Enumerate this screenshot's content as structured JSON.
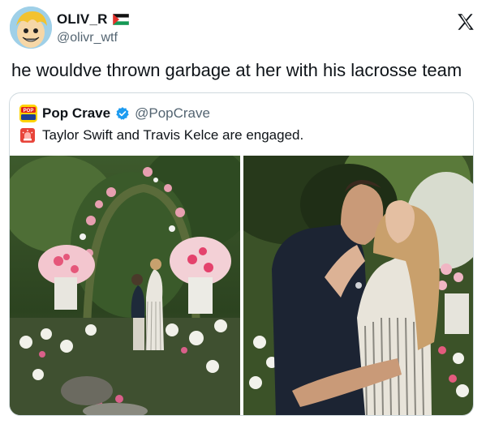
{
  "author": {
    "display_name": "OLIV_R",
    "handle": "@olivr_wtf",
    "avatar_icon": "cartoon-avatar-icon",
    "flag_icon": "palestine-flag-icon"
  },
  "platform_icon": "x-logo-icon",
  "tweet": {
    "text": "he wouldve thrown garbage at her with his lacrosse team"
  },
  "quoted_post": {
    "display_name": "Pop Crave",
    "handle": "@PopCrave",
    "avatar_icon": "pop-crave-logo-icon",
    "verified_icon": "verified-badge-icon",
    "siren_icon": "rotating-light-icon",
    "text": "Taylor Swift and Travis Kelce are engaged.",
    "photos": [
      {
        "name": "garden-proposal-photo"
      },
      {
        "name": "couple-embrace-photo"
      }
    ]
  },
  "colors": {
    "verified_blue": "#1d9bf0",
    "secondary_text": "#536471",
    "border": "#cfd9de"
  }
}
